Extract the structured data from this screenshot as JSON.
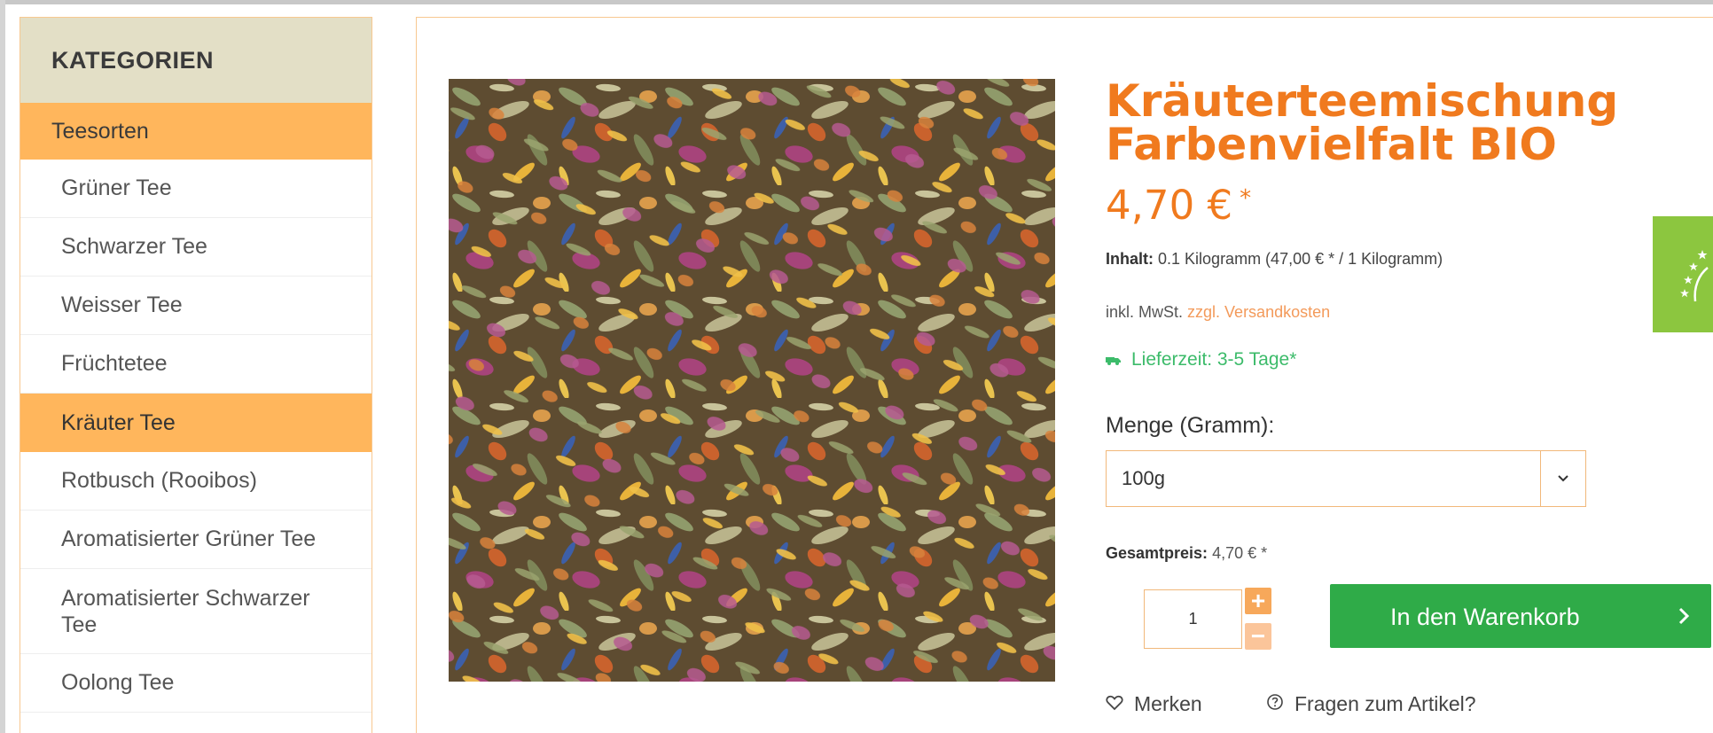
{
  "sidebar": {
    "header": "KATEGORIEN",
    "section": "Teesorten",
    "items": [
      {
        "label": "Grüner Tee",
        "active": false
      },
      {
        "label": "Schwarzer Tee",
        "active": false
      },
      {
        "label": "Weisser Tee",
        "active": false
      },
      {
        "label": "Früchtetee",
        "active": false
      },
      {
        "label": "Kräuter Tee",
        "active": true
      },
      {
        "label": "Rotbusch (Rooibos)",
        "active": false
      },
      {
        "label": "Aromatisierter Grüner Tee",
        "active": false
      },
      {
        "label": "Aromatisierter Schwarzer Tee",
        "active": false
      },
      {
        "label": "Oolong Tee",
        "active": false
      }
    ]
  },
  "product": {
    "title": "Kräuterteemischung Farbenvielfalt BIO",
    "price": "4,70 €",
    "price_star": "*",
    "content_label": "Inhalt:",
    "content_value": "0.1 Kilogramm (47,00 € * / 1 Kilogramm)",
    "tax_text": "inkl. MwSt.",
    "shipping_link": "zzgl. Versandkosten",
    "delivery": "Lieferzeit: 3-5 Tage*",
    "quantity_label": "Menge (Gramm):",
    "quantity_selected": "100g",
    "total_label": "Gesamtpreis:",
    "total_value": "4,70 € *",
    "quantity_input": "1",
    "cart_button": "In den Warenkorb",
    "wishlist": "Merken",
    "question": "Fragen zum Artikel?"
  },
  "colors": {
    "accent_orange": "#f07a1e",
    "sidebar_active": "#ffb65c",
    "cart_green": "#2fab48",
    "delivery_green": "#3cbb6a",
    "bio_green": "#8cc63f"
  },
  "icons": {
    "select_arrow": "chevron-down-icon",
    "qty_plus": "plus-icon",
    "qty_minus": "minus-icon",
    "cart_arrow": "chevron-right-icon",
    "delivery": "truck-icon",
    "wishlist": "heart-icon",
    "question": "question-circle-icon",
    "bio_badge": "eu-organic-leaf-icon"
  }
}
